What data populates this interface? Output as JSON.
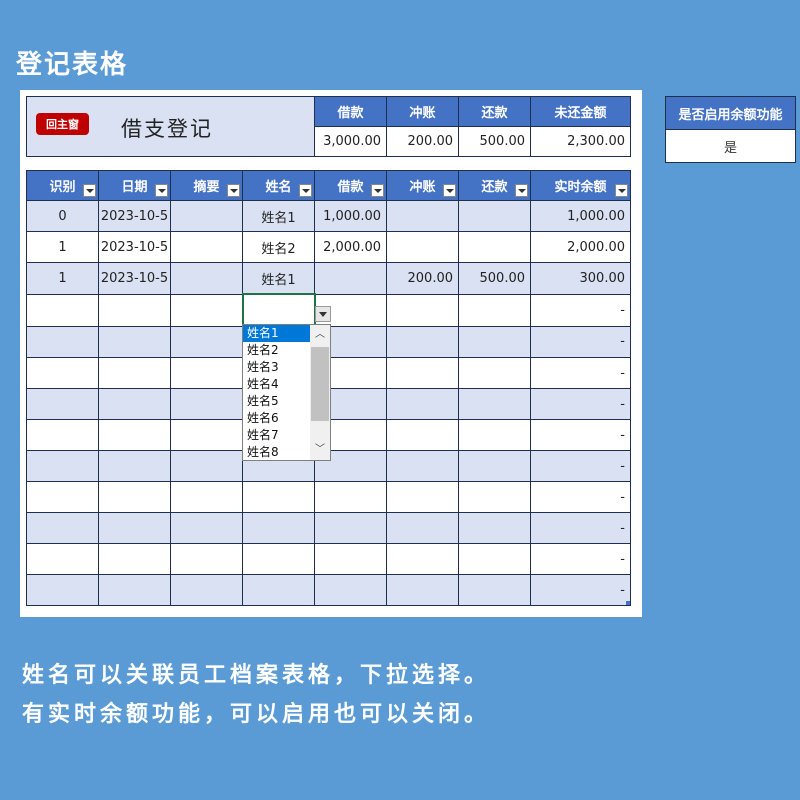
{
  "page_title": "登记表格",
  "home_button": "回主窗",
  "ledger_title": "借支登记",
  "summary": {
    "headers": [
      "借款",
      "冲账",
      "还款",
      "未还金额"
    ],
    "values": [
      "3,000.00",
      "200.00",
      "500.00",
      "2,300.00"
    ]
  },
  "balance_toggle": {
    "label": "是否启用余额功能",
    "value": "是"
  },
  "table": {
    "headers": [
      "识别",
      "日期",
      "摘要",
      "姓名",
      "借款",
      "冲账",
      "还款",
      "实时余额"
    ],
    "rows": [
      [
        "0",
        "2023-10-5",
        "",
        "姓名1",
        "1,000.00",
        "",
        "",
        "1,000.00"
      ],
      [
        "1",
        "2023-10-5",
        "",
        "姓名2",
        "2,000.00",
        "",
        "",
        "2,000.00"
      ],
      [
        "1",
        "2023-10-5",
        "",
        "姓名1",
        "",
        "200.00",
        "500.00",
        "300.00"
      ],
      [
        "",
        "",
        "",
        "",
        "",
        "",
        "",
        "-"
      ],
      [
        "",
        "",
        "",
        "",
        "",
        "",
        "",
        "-"
      ],
      [
        "",
        "",
        "",
        "",
        "",
        "",
        "",
        "-"
      ],
      [
        "",
        "",
        "",
        "",
        "",
        "",
        "",
        "-"
      ],
      [
        "",
        "",
        "",
        "",
        "",
        "",
        "",
        "-"
      ],
      [
        "",
        "",
        "",
        "",
        "",
        "",
        "",
        "-"
      ],
      [
        "",
        "",
        "",
        "",
        "",
        "",
        "",
        "-"
      ],
      [
        "",
        "",
        "",
        "",
        "",
        "",
        "",
        "-"
      ],
      [
        "",
        "",
        "",
        "",
        "",
        "",
        "",
        "-"
      ],
      [
        "",
        "",
        "",
        "",
        "",
        "",
        "",
        "-"
      ]
    ]
  },
  "dropdown": {
    "options": [
      "姓名1",
      "姓名2",
      "姓名3",
      "姓名4",
      "姓名5",
      "姓名6",
      "姓名7",
      "姓名8"
    ],
    "selected": "姓名1"
  },
  "captions": [
    "姓名可以关联员工档案表格，下拉选择。",
    "有实时余额功能，可以启用也可以关闭。"
  ],
  "colors": {
    "background": "#5b9bd5",
    "header": "#4472c4",
    "row_alt": "#d9e1f2",
    "home_button": "#c00000",
    "selection": "#0078d7"
  }
}
